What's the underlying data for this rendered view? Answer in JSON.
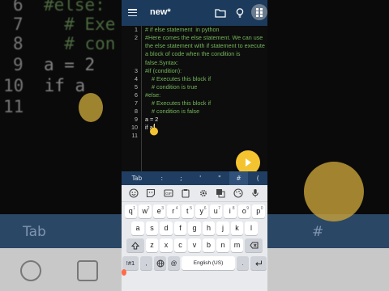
{
  "background": {
    "code_lines": [
      {
        "num": "6",
        "text": "#else:"
      },
      {
        "num": "7",
        "text": "# Exe"
      },
      {
        "num": "8",
        "text": "# con"
      },
      {
        "num": "9",
        "text": "a = 2"
      },
      {
        "num": "10",
        "text": "if a"
      },
      {
        "num": "11",
        "text": ""
      }
    ],
    "symbar_tab": "Tab",
    "symbar_hash": "#",
    "colors": {
      "accent": "#f4c430",
      "toolbar": "#1c3a5c"
    }
  },
  "app": {
    "title": "new*",
    "icons": {
      "menu": "menu-icon",
      "folder": "folder-icon",
      "bulb": "lightbulb-icon",
      "grid": "grid-icon"
    }
  },
  "editor": {
    "lines": [
      {
        "num": "1",
        "text": "# if else statement  in python",
        "color": "green"
      },
      {
        "num": "2",
        "text": "#Here comes the else statement. We can use the else statement with if statement to execute a block of code when the condition is false.Syntax:",
        "color": "green"
      },
      {
        "num": "3",
        "text": "#if (condition):",
        "color": "green"
      },
      {
        "num": "4",
        "text": "    # Executes this block if",
        "color": "green"
      },
      {
        "num": "5",
        "text": "    # condition is true",
        "color": "green"
      },
      {
        "num": "6",
        "text": "#else:",
        "color": "green"
      },
      {
        "num": "7",
        "text": "    # Executes this block if",
        "color": "green"
      },
      {
        "num": "8",
        "text": "    # condition is false",
        "color": "green"
      },
      {
        "num": "9",
        "text": "a = 2",
        "color": "white"
      },
      {
        "num": "10",
        "text": "if a",
        "color": "white"
      },
      {
        "num": "11",
        "text": "",
        "color": "white"
      }
    ]
  },
  "fab": {
    "icon": "play-icon"
  },
  "symbols": [
    "Tab",
    ":",
    ";",
    "'",
    "\"",
    "#",
    "("
  ],
  "keyboard": {
    "tools": [
      "emoji-icon",
      "sticker-icon",
      "gif-icon",
      "clipboard-icon",
      "settings-icon",
      "translate-icon",
      "palette-icon",
      "mic-icon"
    ],
    "row1": [
      [
        "q",
        "1"
      ],
      [
        "w",
        "2"
      ],
      [
        "e",
        "3"
      ],
      [
        "r",
        "4"
      ],
      [
        "t",
        "5"
      ],
      [
        "y",
        "6"
      ],
      [
        "u",
        "7"
      ],
      [
        "i",
        "8"
      ],
      [
        "o",
        "9"
      ],
      [
        "p",
        "0"
      ]
    ],
    "row2": [
      "a",
      "s",
      "d",
      "f",
      "g",
      "h",
      "j",
      "k",
      "l"
    ],
    "row3": [
      "z",
      "x",
      "c",
      "v",
      "b",
      "n",
      "m"
    ],
    "row4": {
      "symbols": "!#1",
      "comma": ",",
      "at": "@",
      "space": "English (US)",
      "period": "."
    }
  }
}
